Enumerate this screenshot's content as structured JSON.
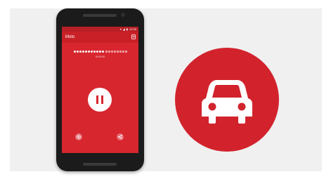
{
  "app": {
    "title": "Moto",
    "status_time": "12:30",
    "timer_text": "00:00:00"
  },
  "progress": {
    "filled": 11,
    "total": 19
  },
  "colors": {
    "primary_red": "#d7262e",
    "statusbar_red": "#b81f26",
    "badge_red": "#d2232d",
    "phone_body": "#1b1b1b"
  },
  "icons": {
    "menu": "menu-icon",
    "pause": "pause-icon",
    "stop": "stop-icon",
    "share": "share-icon",
    "car": "car-icon"
  }
}
